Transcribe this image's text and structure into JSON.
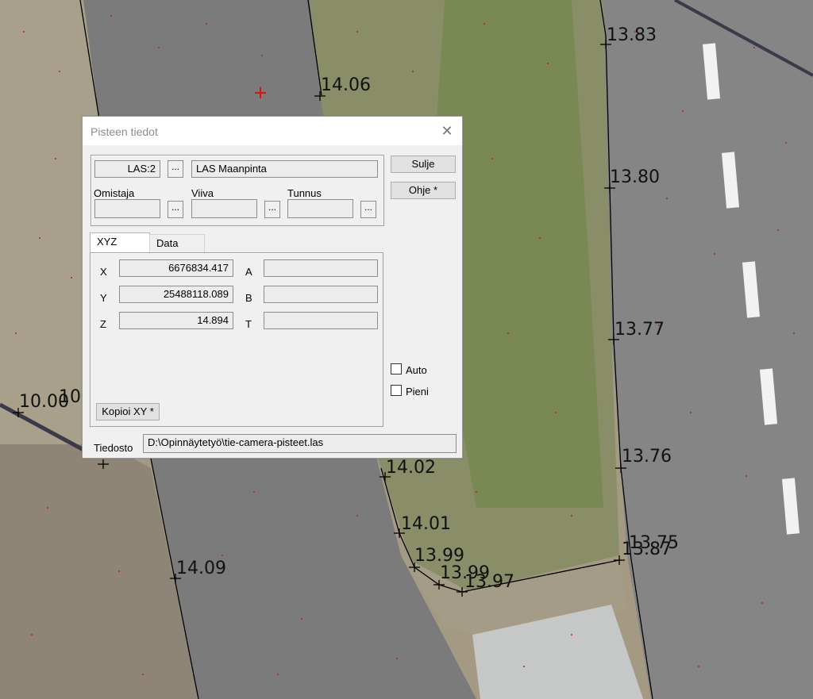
{
  "map": {
    "elevation_labels": [
      "13.83",
      "14.06",
      "13.80",
      "13.77",
      "10.00",
      "10",
      "13.76",
      "14.02",
      "14.01",
      "13.99",
      "13.99",
      "13.97",
      "13.75",
      "13.87",
      "14.09"
    ]
  },
  "dialog": {
    "title": "Pisteen tiedot",
    "class_value": "LAS:2",
    "class_name": "LAS Maanpinta",
    "browse_label": "...",
    "owner_label": "Omistaja",
    "line_label": "Viiva",
    "id_label": "Tunnus",
    "owner_value": "",
    "line_value": "",
    "id_value": "",
    "close_button": "Sulje",
    "help_button": "Ohje *",
    "tabs": [
      "XYZ",
      "Data"
    ],
    "coords": {
      "x_label": "X",
      "x_value": "6676834.417",
      "y_label": "Y",
      "y_value": "25488118.089",
      "z_label": "Z",
      "z_value": "14.894",
      "a_label": "A",
      "a_value": "",
      "b_label": "B",
      "b_value": "",
      "t_label": "T",
      "t_value": ""
    },
    "copy_button": "Kopioi XY *",
    "auto_label": "Auto",
    "small_label": "Pieni",
    "auto_checked": false,
    "small_checked": false,
    "file_label": "Tiedosto",
    "file_value": "D:\\Opinnäytetyö\\tie-camera-pisteet.las"
  },
  "colors": {
    "road": "#7b7b7b",
    "grass": "#7d8a5a",
    "sand": "#b0a58e",
    "paving": "#c6c8c8",
    "lane_marking": "#f2f2f2",
    "point_marker": "#b02020",
    "cursor_marker": "#e01010"
  }
}
